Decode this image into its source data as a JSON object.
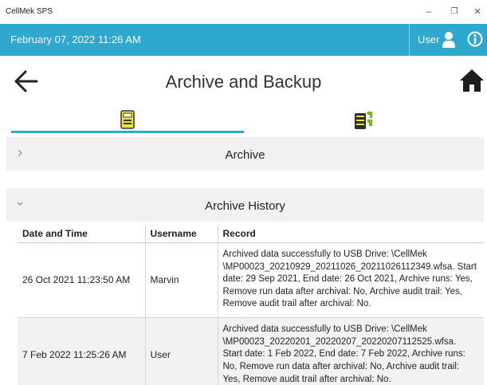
{
  "window": {
    "app_title": "CellMek SPS",
    "minimize_glyph": "–",
    "restore_glyph": "❐",
    "close_glyph": "✕"
  },
  "topbar": {
    "datetime": "February 07, 2022 11:26 AM",
    "user_label": "User",
    "accent_color": "#2fa8d0",
    "user_icon": "user-icon",
    "info_icon": "info-icon"
  },
  "header": {
    "title": "Archive and Backup",
    "back_icon": "back-arrow-icon",
    "home_icon": "home-icon"
  },
  "tabs": [
    {
      "name": "archive",
      "icon": "archive-device-icon",
      "active": true
    },
    {
      "name": "backup",
      "icon": "backup-server-icon",
      "active": false
    }
  ],
  "sections": {
    "archive": {
      "label": "Archive",
      "expanded": false
    },
    "history": {
      "label": "Archive History",
      "expanded": true
    }
  },
  "history_table": {
    "columns": [
      "Date and Time",
      "Username",
      "Record"
    ],
    "rows": [
      {
        "datetime": "26 Oct 2021 11:23:50 AM",
        "username": "Marvin",
        "record": "Archived data successfully to USB Drive: \\CellMek \\MP00023_20210929_20211026_20211026112349.wfsa. Start date: 29 Sep 2021, End date: 26 Oct 2021, Archive runs: Yes, Remove run data after archival: No, Archive audit trail: Yes, Remove audit trail after archival: No."
      },
      {
        "datetime": "7 Feb 2022 11:25:26 AM",
        "username": "User",
        "record": "Archived data successfully to USB Drive: \\CellMek \\MP00023_20220201_20220207_20220207112525.wfsa. Start date: 1 Feb 2022, End date: 7 Feb 2022, Archive runs: No, Remove run data after archival: No, Archive audit trail: Yes, Remove audit trail after archival: No."
      }
    ]
  }
}
